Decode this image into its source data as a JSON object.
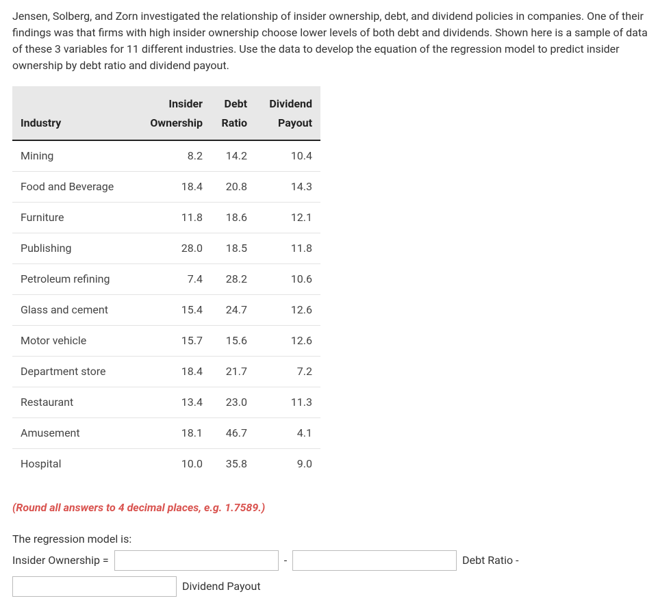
{
  "intro": "Jensen, Solberg, and Zorn investigated the relationship of insider ownership, debt, and dividend policies in companies. One of their findings was that firms with high insider ownership choose lower levels of both debt and dividends. Shown here is a sample of data of these 3 variables for 11 different industries. Use the data to develop the equation of the regression model to predict insider ownership by debt ratio and dividend payout.",
  "table": {
    "header_top": {
      "col1": "",
      "col2": "Insider",
      "col3": "Debt",
      "col4": "Dividend"
    },
    "header_bot": {
      "col1": "Industry",
      "col2": "Ownership",
      "col3": "Ratio",
      "col4": "Payout"
    },
    "rows": [
      {
        "industry": "Mining",
        "ownership": "8.2",
        "debt": "14.2",
        "dividend": "10.4"
      },
      {
        "industry": "Food and Beverage",
        "ownership": "18.4",
        "debt": "20.8",
        "dividend": "14.3"
      },
      {
        "industry": "Furniture",
        "ownership": "11.8",
        "debt": "18.6",
        "dividend": "12.1"
      },
      {
        "industry": "Publishing",
        "ownership": "28.0",
        "debt": "18.5",
        "dividend": "11.8"
      },
      {
        "industry": "Petroleum refining",
        "ownership": "7.4",
        "debt": "28.2",
        "dividend": "10.6"
      },
      {
        "industry": "Glass and cement",
        "ownership": "15.4",
        "debt": "24.7",
        "dividend": "12.6"
      },
      {
        "industry": "Motor vehicle",
        "ownership": "15.7",
        "debt": "15.6",
        "dividend": "12.6"
      },
      {
        "industry": "Department store",
        "ownership": "18.4",
        "debt": "21.7",
        "dividend": "7.2"
      },
      {
        "industry": "Restaurant",
        "ownership": "13.4",
        "debt": "23.0",
        "dividend": "11.3"
      },
      {
        "industry": "Amusement",
        "ownership": "18.1",
        "debt": "46.7",
        "dividend": "4.1"
      },
      {
        "industry": "Hospital",
        "ownership": "10.0",
        "debt": "35.8",
        "dividend": "9.0"
      }
    ]
  },
  "hint": "(Round all answers to 4 decimal places, e.g. 1.7589.)",
  "model": {
    "label": "The regression model is:",
    "lhs": "Insider Ownership =",
    "minus": "-",
    "term1_suffix": "Debt Ratio -",
    "term2_suffix": "Dividend Payout"
  }
}
